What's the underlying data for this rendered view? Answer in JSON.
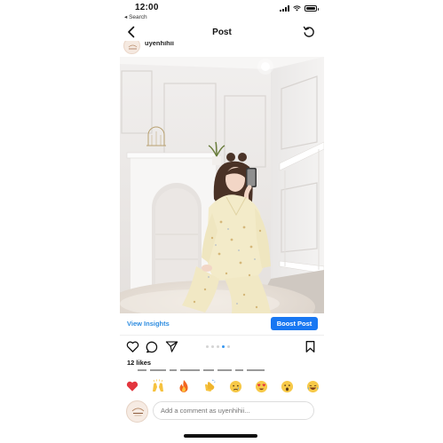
{
  "status": {
    "time": "12:00",
    "back_label": "◂ Search"
  },
  "header": {
    "title": "Post"
  },
  "author": {
    "username": "uyenhihii",
    "avatar_text": "Uyenhi Sleepwear"
  },
  "insights": {
    "view_label": "View Insights",
    "boost_label": "Boost Post"
  },
  "carousel": {
    "dot_count": 5,
    "active_index": 3
  },
  "likes": {
    "text": "12 likes"
  },
  "emojis": [
    "heart",
    "raising-hands",
    "fire",
    "clapping-hands",
    "crying-face",
    "heart-eyes-face",
    "surprised-face",
    "laughing-face"
  ],
  "comment": {
    "placeholder": "Add a comment as uyenhihii..."
  },
  "colors": {
    "accent": "#1877f2",
    "link": "#2d8ce0",
    "heart_red": "#e3363e"
  }
}
